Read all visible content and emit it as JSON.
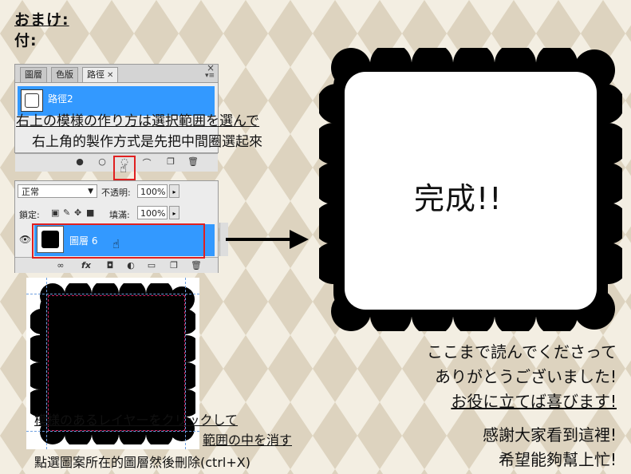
{
  "header": {
    "line1": "おまけ:",
    "line2": "付:"
  },
  "paths_panel": {
    "tabs": [
      "圖層",
      "色版",
      "路徑"
    ],
    "path_name": "路徑2"
  },
  "layers_panel": {
    "blend_mode": "正常",
    "opacity_label": "不透明:",
    "opacity_value": "100%",
    "lock_label": "鎖定:",
    "fill_label": "填滿:",
    "fill_value": "100%",
    "layer_name": "圖層 6"
  },
  "annotations": {
    "step1_jp": "右上の模様の作り方は選択範囲を選んで",
    "step1_zh": "右上角的製作方式是先把中間圈選起來",
    "step2_jp_a": "模様のあるレイヤーをクリックして",
    "step2_jp_b": "範囲の中を消す",
    "step2_zh": "點選圖案所在的圖層然後刪除(ctrl+X)"
  },
  "result": {
    "label": "完成!!"
  },
  "thanks": {
    "jp1": "ここまで読んでくださって",
    "jp2": "ありがとうございました!",
    "jp3": "お役に立てば喜びます!",
    "zh1": "感謝大家看到這裡!",
    "zh2": "希望能夠幫上忙!"
  },
  "icons": {
    "panel_close": "close-icon",
    "menu": "panel-menu-icon",
    "eye": "eye-icon",
    "cursor": "hand-cursor-icon",
    "lock": "lock-icon",
    "trash": "trash-icon"
  },
  "colors": {
    "selection_blue": "#3399ff",
    "highlight_red": "#e02020",
    "bg_cream": "#f3eee2",
    "bg_diamond": "#ddd3bf"
  }
}
